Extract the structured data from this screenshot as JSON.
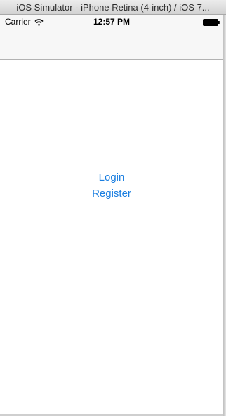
{
  "window": {
    "title": "iOS Simulator - iPhone Retina (4-inch) / iOS 7..."
  },
  "status_bar": {
    "carrier": "Carrier",
    "time": "12:57 PM",
    "wifi_icon": "wifi-icon",
    "battery_icon": "battery-icon"
  },
  "main": {
    "login_label": "Login",
    "register_label": "Register"
  },
  "colors": {
    "button_tint": "#1a7ee0",
    "bar_background": "#f7f7f7",
    "screen_background": "#ffffff"
  }
}
